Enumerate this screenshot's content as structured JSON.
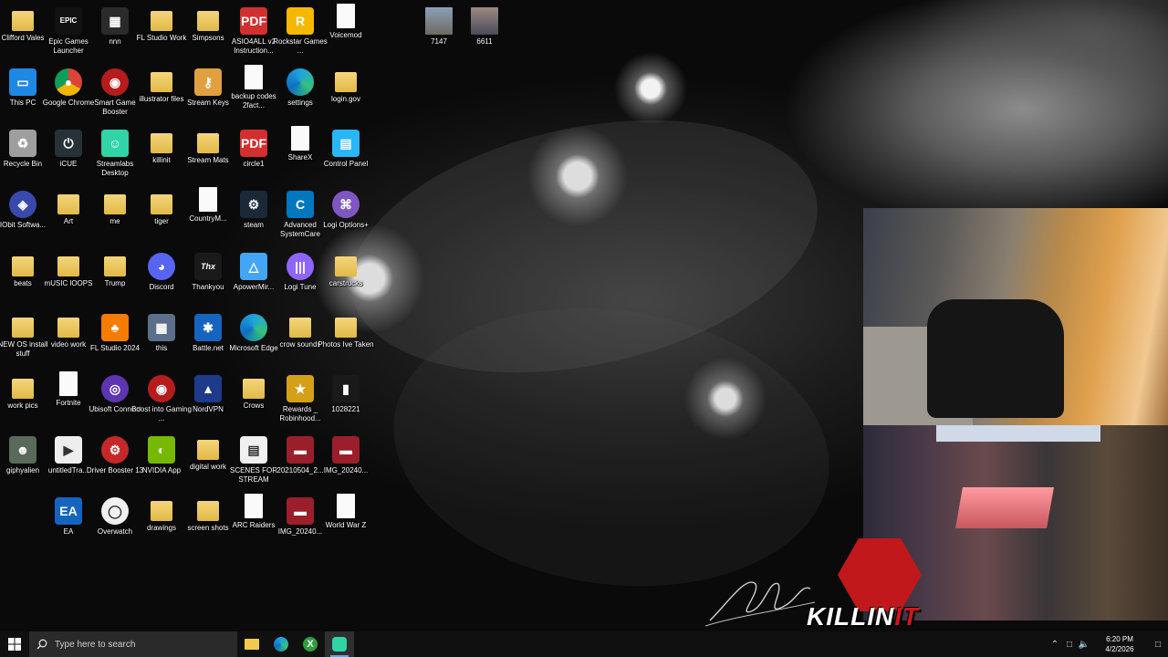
{
  "desktop": {
    "icons": [
      {
        "label": "Clifford Vales",
        "type": "folder"
      },
      {
        "label": "Epic Games Launcher",
        "type": "epic"
      },
      {
        "label": "nnn",
        "type": "app"
      },
      {
        "label": "FL Studio Work",
        "type": "folder"
      },
      {
        "label": "Simpsons",
        "type": "folder"
      },
      {
        "label": "ASIO4ALL v2 Instruction...",
        "type": "pdf"
      },
      {
        "label": "Rockstar Games ...",
        "type": "rockstar"
      },
      {
        "label": "Voicemod",
        "type": "doc"
      },
      {
        "label": "This PC",
        "type": "pc"
      },
      {
        "label": "Google Chrome",
        "type": "chrome"
      },
      {
        "label": "Smart Game Booster",
        "type": "booster"
      },
      {
        "label": "illustrator files",
        "type": "folder"
      },
      {
        "label": "Stream Keys",
        "type": "keys"
      },
      {
        "label": "backup codes 2fact...",
        "type": "doc"
      },
      {
        "label": "settings",
        "type": "edge"
      },
      {
        "label": "login.gov",
        "type": "folder"
      },
      {
        "label": "Recycle Bin",
        "type": "recycle"
      },
      {
        "label": "iCUE",
        "type": "icue"
      },
      {
        "label": "Streamlabs Desktop",
        "type": "streamlabs"
      },
      {
        "label": "killinit",
        "type": "folder"
      },
      {
        "label": "Stream Mats",
        "type": "folder"
      },
      {
        "label": "circle1",
        "type": "pdf"
      },
      {
        "label": "ShareX",
        "type": "doc"
      },
      {
        "label": "Control Panel",
        "type": "control"
      },
      {
        "label": "IObit Softwa...",
        "type": "iobit"
      },
      {
        "label": "Art",
        "type": "folder"
      },
      {
        "label": "me",
        "type": "folder"
      },
      {
        "label": "tiger",
        "type": "folder"
      },
      {
        "label": "CountryM...",
        "type": "doc"
      },
      {
        "label": "steam",
        "type": "steam"
      },
      {
        "label": "Advanced SystemCare",
        "type": "asc"
      },
      {
        "label": "Logi Options+",
        "type": "logi"
      },
      {
        "label": "beats",
        "type": "folder"
      },
      {
        "label": "mUSIC lOOPS",
        "type": "folder"
      },
      {
        "label": "Trump",
        "type": "folder"
      },
      {
        "label": "Discord",
        "type": "discord"
      },
      {
        "label": "Thankyou",
        "type": "thankyou"
      },
      {
        "label": "ApowerMir...",
        "type": "apower"
      },
      {
        "label": "Logi Tune",
        "type": "logitune"
      },
      {
        "label": "carstrucks",
        "type": "folder"
      },
      {
        "label": "NEW OS install stuff",
        "type": "folder"
      },
      {
        "label": "video work",
        "type": "folder"
      },
      {
        "label": "FL Studio 2024",
        "type": "fl"
      },
      {
        "label": "this",
        "type": "image"
      },
      {
        "label": "Battle.net",
        "type": "battlenet"
      },
      {
        "label": "Microsoft Edge",
        "type": "edge"
      },
      {
        "label": "crow sounds",
        "type": "folder"
      },
      {
        "label": "Photos Ive Taken",
        "type": "folder"
      },
      {
        "label": "work pics",
        "type": "folder"
      },
      {
        "label": "Fortnite",
        "type": "doc"
      },
      {
        "label": "Ubisoft Connect",
        "type": "ubisoft"
      },
      {
        "label": "Boost into Gaming ...",
        "type": "booster"
      },
      {
        "label": "NordVPN",
        "type": "nord"
      },
      {
        "label": "Crows",
        "type": "folder"
      },
      {
        "label": "Rewards _ Robinhood...",
        "type": "star"
      },
      {
        "label": "1028221",
        "type": "green"
      },
      {
        "label": "giphyalien",
        "type": "alien"
      },
      {
        "label": "untitledTra...",
        "type": "video"
      },
      {
        "label": "Driver Booster 13",
        "type": "driver"
      },
      {
        "label": "NVIDIA App",
        "type": "nvidia"
      },
      {
        "label": "digital work",
        "type": "folder"
      },
      {
        "label": "SCENES FOR STREAM",
        "type": "scenes"
      },
      {
        "label": "20210504_2...",
        "type": "photo"
      },
      {
        "label": "IMG_20240...",
        "type": "photo"
      },
      {
        "label": "",
        "type": "none"
      },
      {
        "label": "EA",
        "type": "ea"
      },
      {
        "label": "Overwatch",
        "type": "overwatch"
      },
      {
        "label": "drawings",
        "type": "folder"
      },
      {
        "label": "screen shots",
        "type": "folder"
      },
      {
        "label": "ARC Raiders",
        "type": "doc"
      },
      {
        "label": "IMG_20240...",
        "type": "photo"
      },
      {
        "label": "World War Z",
        "type": "doc"
      }
    ],
    "extra_icons": [
      {
        "label": "7147"
      },
      {
        "label": "6611"
      }
    ],
    "logo_text_a": "KILLIN",
    "logo_text_b": "IT"
  },
  "taskbar": {
    "search_placeholder": "Type here to search",
    "apps": [
      "file-explorer",
      "edge",
      "xbox",
      "streamlabs"
    ],
    "clock_time": "6:20 PM",
    "clock_date": "4/2/2026"
  }
}
